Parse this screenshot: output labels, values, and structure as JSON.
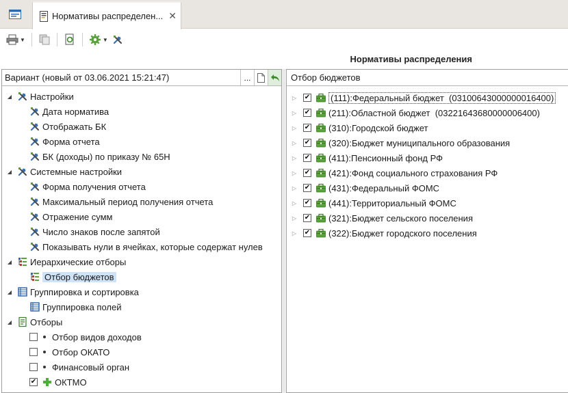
{
  "tabs": {
    "home_icon": "window-icon",
    "active_title": "Нормативы распределен...",
    "close": "✕"
  },
  "toolbar": {
    "print_icon": "printer-icon",
    "copy_icon": "copy-icon",
    "refresh_icon": "refresh-icon",
    "settings_icon": "gear-icon",
    "tools_icon": "tools-icon"
  },
  "page_title": "Нормативы распределения",
  "left_panel": {
    "variant_label": "Вариант (новый от 03.06.2021 15:21:47)",
    "btn_more": "...",
    "tree": [
      {
        "label": "Настройки",
        "level": 0,
        "icon": "tools-icon"
      },
      {
        "label": "Дата норматива",
        "level": 1,
        "icon": "tools-icon"
      },
      {
        "label": "Отображать БК",
        "level": 1,
        "icon": "tools-icon"
      },
      {
        "label": "Форма отчета",
        "level": 1,
        "icon": "tools-icon"
      },
      {
        "label": "БК (доходы) по приказу № 65Н",
        "level": 1,
        "icon": "tools-icon"
      },
      {
        "label": "Системные настройки",
        "level": 0,
        "icon": "tools-icon"
      },
      {
        "label": "Форма получения отчета",
        "level": 1,
        "icon": "tools-icon"
      },
      {
        "label": "Максимальный период получения отчета",
        "level": 1,
        "icon": "tools-icon"
      },
      {
        "label": "Отражение сумм",
        "level": 1,
        "icon": "tools-icon"
      },
      {
        "label": "Число знаков после запятой",
        "level": 1,
        "icon": "tools-icon"
      },
      {
        "label": "Показывать нули в ячейках, которые содержат нулев",
        "level": 1,
        "icon": "tools-icon"
      },
      {
        "label": "Иерархические отборы",
        "level": 0,
        "icon": "hierarchy-icon"
      },
      {
        "label": "Отбор бюджетов",
        "level": 1,
        "icon": "hierarchy-icon",
        "selected": true
      },
      {
        "label": "Группировка и сортировка",
        "level": 0,
        "icon": "grouping-icon"
      },
      {
        "label": "Группировка полей",
        "level": 1,
        "icon": "grouping-icon"
      },
      {
        "label": "Отборы",
        "level": 0,
        "icon": "filter-icon"
      },
      {
        "label": "Отбор видов доходов",
        "level": 1,
        "checkbox": false,
        "icon": "bullet"
      },
      {
        "label": "Отбор ОКАТО",
        "level": 1,
        "checkbox": false,
        "icon": "bullet"
      },
      {
        "label": "Финансовый орган",
        "level": 1,
        "checkbox": false,
        "icon": "bullet"
      },
      {
        "label": "ОКТМО",
        "level": 1,
        "checkbox": true,
        "icon": "plus-icon"
      }
    ]
  },
  "right_panel": {
    "header": "Отбор бюджетов",
    "items": [
      {
        "label": "(111):Федеральный бюджет  (03100643000000016400)",
        "checked": true,
        "focused": true
      },
      {
        "label": "(211):Областной бюджет  (03221643680000006400)",
        "checked": true
      },
      {
        "label": "(310):Городской бюджет",
        "checked": true
      },
      {
        "label": "(320):Бюджет муниципального образования",
        "checked": true
      },
      {
        "label": "(411):Пенсионный фонд РФ",
        "checked": true
      },
      {
        "label": "(421):Фонд социального страхования РФ",
        "checked": true
      },
      {
        "label": "(431):Федеральный ФОМС",
        "checked": true
      },
      {
        "label": "(441):Территориальный ФОМС",
        "checked": true
      },
      {
        "label": "(321):Бюджет сельского поселения",
        "checked": true
      },
      {
        "label": "(322):Бюджет городского поселения",
        "checked": true
      }
    ]
  },
  "colors": {
    "selection": "#cfe3f8",
    "tab_strip": "#e9e6e1",
    "budget_icon": "#5aa23c"
  }
}
